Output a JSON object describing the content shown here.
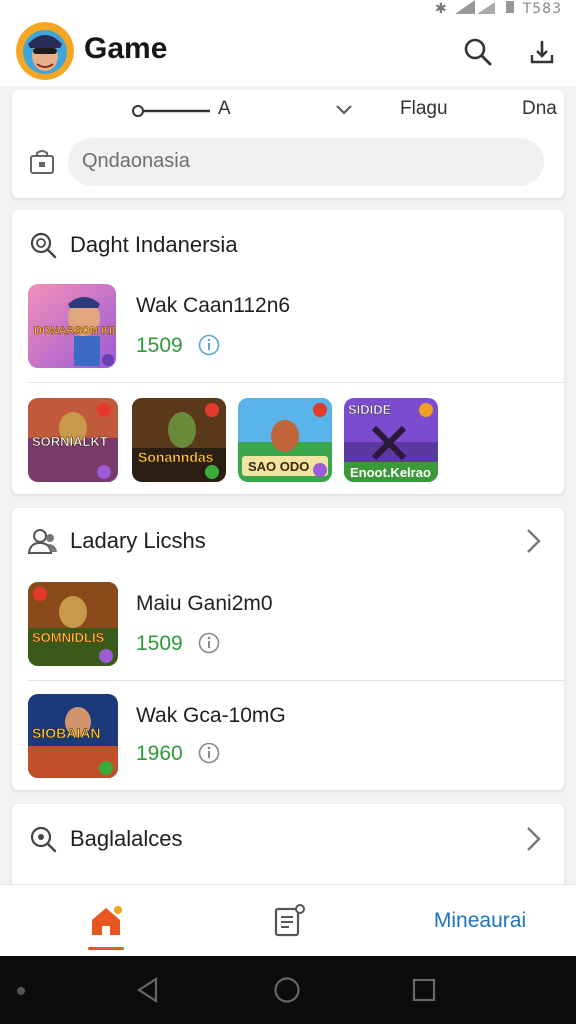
{
  "status": {
    "time": "T583"
  },
  "appbar": {
    "title": "Game",
    "search_icon": "search-icon",
    "download_icon": "download-icon"
  },
  "filter": {
    "items": [
      "A",
      "Flagu",
      "Dna"
    ],
    "search_placeholder": "Qndaonasia"
  },
  "section1": {
    "title": "Daght Indanersia",
    "featured": {
      "name": "Wak Caan112n6",
      "score": "1509",
      "thumb_text": "DONARSON KIDDIE"
    },
    "tiles": [
      {
        "label": "SORNIALKT"
      },
      {
        "label": "Sonanndas"
      },
      {
        "label": "SAO ODO"
      },
      {
        "label": "Enoot.Kelrao",
        "top_text": "SIDIDE"
      }
    ]
  },
  "section2": {
    "title": "Ladary Licshs",
    "games": [
      {
        "name": "Maiu Gani2m0",
        "score": "1509",
        "thumb_text": "SOMNIDLIS"
      },
      {
        "name": "Wak Gca-10mG",
        "score": "1960",
        "thumb_text": "SIOBAIAN"
      }
    ]
  },
  "section3": {
    "title": "Baglalalces"
  },
  "bottomnav": {
    "items": [
      {
        "icon": "home-icon"
      },
      {
        "icon": "notes-icon"
      }
    ],
    "label": "Mineaurai"
  },
  "colors": {
    "accent": "#e8561f",
    "score": "#2e9a3a",
    "link": "#1e73be"
  }
}
